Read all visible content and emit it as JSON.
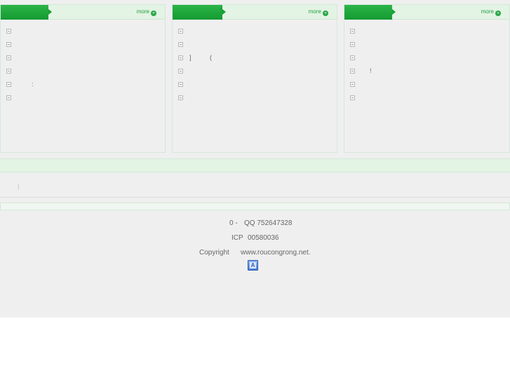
{
  "panels": [
    {
      "more_label": "more",
      "more_icon": "double-arrow-right-icon",
      "items": [
        {
          "text": ""
        },
        {
          "text": ""
        },
        {
          "text": ""
        },
        {
          "text": ""
        },
        {
          "text": ":"
        },
        {
          "text": ""
        }
      ]
    },
    {
      "more_label": "more",
      "more_icon": "double-arrow-right-icon",
      "items": [
        {
          "text": ""
        },
        {
          "text": ""
        },
        {
          "text": "]"
        },
        {
          "text": ""
        },
        {
          "text": ""
        },
        {
          "text": ""
        }
      ],
      "extra_mark": "("
    },
    {
      "more_label": "more",
      "more_icon": "double-arrow-right-icon",
      "items": [
        {
          "text": ""
        },
        {
          "text": ""
        },
        {
          "text": ""
        },
        {
          "text": "!"
        },
        {
          "text": ""
        },
        {
          "text": ""
        }
      ]
    }
  ],
  "links_separator": "|",
  "footer": {
    "line1_a": "0 -",
    "line1_b": "QQ 752647328",
    "line2_a": "ICP",
    "line2_b": "00580036",
    "line3_a": "Copyright",
    "line3_b": "www.roucongrong.net.",
    "badge_text": "A"
  },
  "colors": {
    "accent_green": "#149a32",
    "header_green": "#e3f3e4",
    "page_gray": "#efefef"
  }
}
